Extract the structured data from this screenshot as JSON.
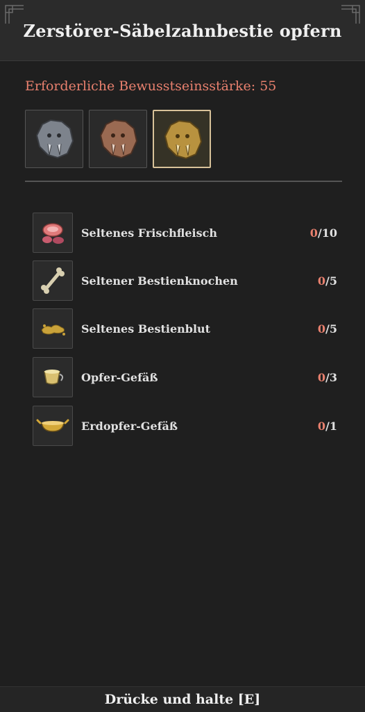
{
  "header": {
    "title": "Zerstörer-Säbelzahnbestie opfern"
  },
  "requirement": "Erforderliche Bewusstseinsstärke: 55",
  "tiers": [
    {
      "icon": "sabertooth-beast-silver-icon",
      "color": "#9a9fa6",
      "selected": false
    },
    {
      "icon": "sabertooth-beast-bronze-icon",
      "color": "#b07d62",
      "selected": false
    },
    {
      "icon": "sabertooth-beast-gold-icon",
      "color": "#c9a24e",
      "selected": true
    }
  ],
  "materials": [
    {
      "icon": "raw-meat-icon",
      "name": "Seltenes Frischfleisch",
      "have": "0",
      "need": "/10"
    },
    {
      "icon": "bone-icon",
      "name": "Seltener Bestienknochen",
      "have": "0",
      "need": "/5"
    },
    {
      "icon": "blood-icon",
      "name": "Seltenes Bestienblut",
      "have": "0",
      "need": "/5"
    },
    {
      "icon": "cup-icon",
      "name": "Opfer-Gefäß",
      "have": "0",
      "need": "/3"
    },
    {
      "icon": "bowl-icon",
      "name": "Erdopfer-Gefäß",
      "have": "0",
      "need": "/1"
    }
  ],
  "footer": {
    "hint": "Drücke und halte [E]"
  },
  "colors": {
    "accent_red": "#e8806e",
    "selected_border": "#d9c39a"
  }
}
